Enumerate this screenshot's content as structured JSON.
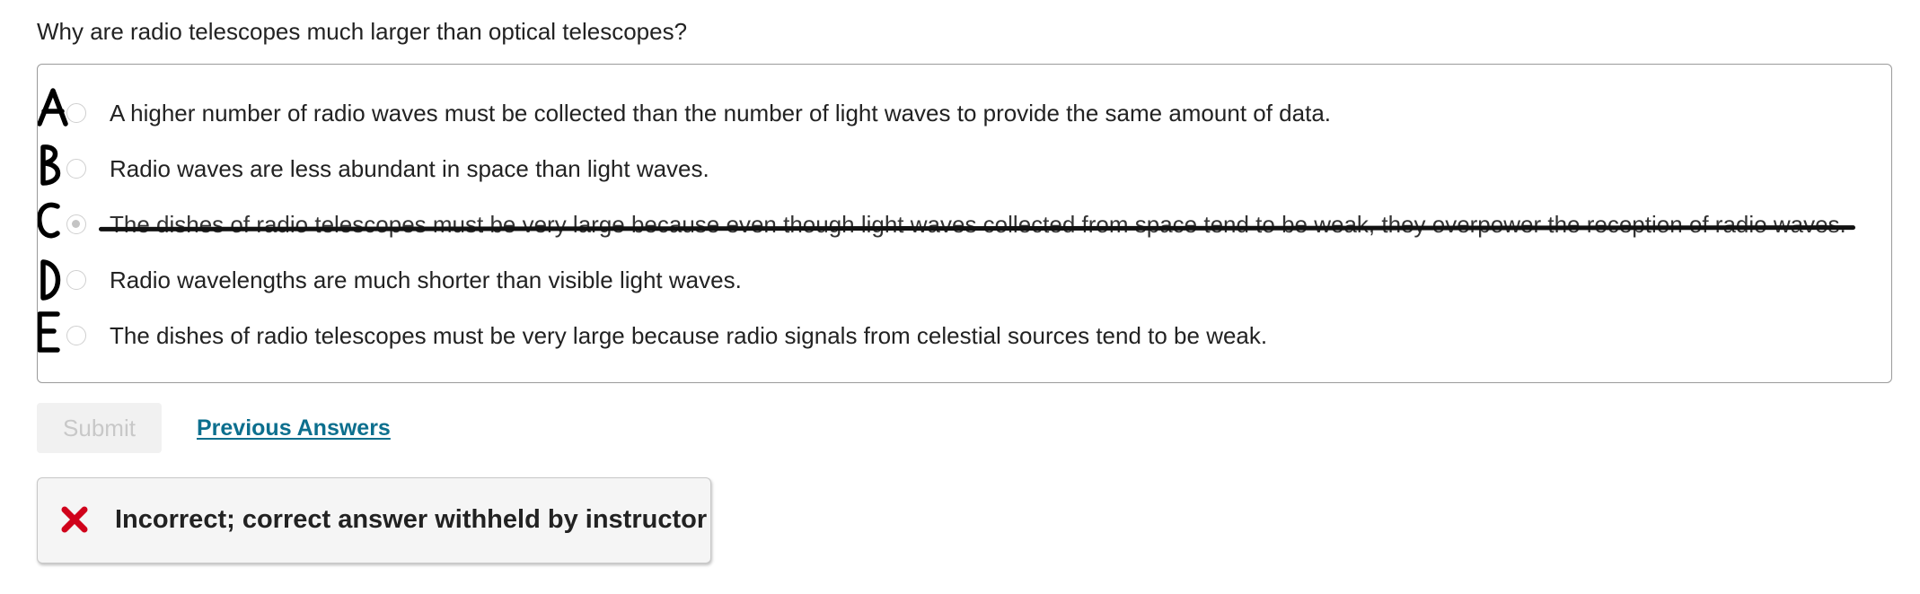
{
  "question": {
    "text": "Why are radio telescopes much larger than optical telescopes?"
  },
  "choices": [
    {
      "letter": "A",
      "text": "A higher number of radio waves must be collected than the number of light waves to provide the same amount of data.",
      "selected": false,
      "struck": false
    },
    {
      "letter": "B",
      "text": "Radio waves are less abundant in space than light waves.",
      "selected": false,
      "struck": false
    },
    {
      "letter": "C",
      "text": "The dishes of radio telescopes must be very large because even though light waves collected from space tend to be weak, they overpower the reception of radio waves.",
      "selected": true,
      "struck": true
    },
    {
      "letter": "D",
      "text": "Radio wavelengths are much shorter than visible light waves.",
      "selected": false,
      "struck": false
    },
    {
      "letter": "E",
      "text": "The dishes of radio telescopes must be very large because radio signals from celestial sources tend to be weak.",
      "selected": false,
      "struck": false
    }
  ],
  "actions": {
    "submit_label": "Submit",
    "submit_enabled": false,
    "previous_answers_label": "Previous Answers"
  },
  "feedback": {
    "icon": "close-icon",
    "text": "Incorrect; correct answer withheld by instructor",
    "icon_color": "#d0021b"
  },
  "colors": {
    "link": "#0c6f8e",
    "text": "#222222",
    "border": "#9a9a9a"
  }
}
